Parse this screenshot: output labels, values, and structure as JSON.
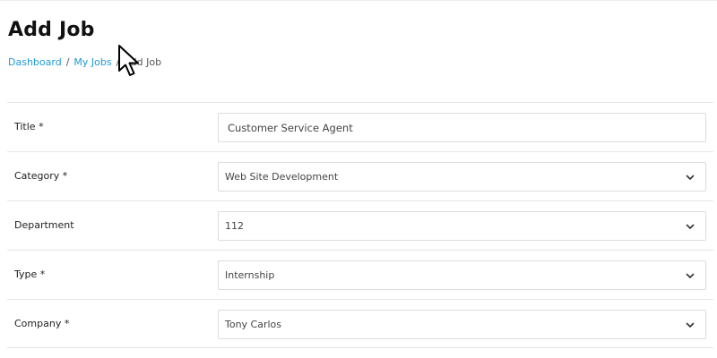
{
  "page": {
    "title": "Add Job"
  },
  "breadcrumb": {
    "items": [
      "Dashboard",
      "My Jobs",
      "Add Job"
    ],
    "separator": "/"
  },
  "form": {
    "fields": [
      {
        "label": "Title *",
        "type": "text",
        "value": "Customer Service Agent"
      },
      {
        "label": "Category *",
        "type": "select",
        "value": "Web Site Development",
        "icon": "chevron-down-icon"
      },
      {
        "label": "Department",
        "type": "select",
        "value": "112",
        "icon": "chevron-down-icon"
      },
      {
        "label": "Type *",
        "type": "select",
        "value": "Internship",
        "icon": "chevron-down-icon"
      },
      {
        "label": "Company *",
        "type": "select",
        "value": "Tony Carlos",
        "icon": "chevron-down-icon"
      }
    ]
  },
  "colors": {
    "link": "#1e9ad6",
    "title": "#111111",
    "border": "#dcdcdc"
  },
  "cursor": {
    "icon": "mouse-pointer-icon"
  }
}
